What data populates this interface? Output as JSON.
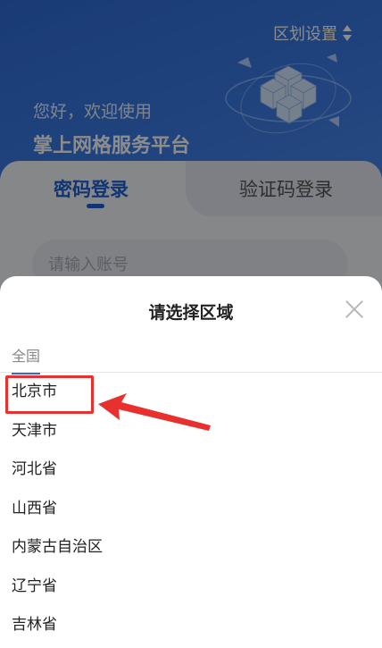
{
  "header": {
    "region_setting_label": "区划设置",
    "greeting": "您好，欢迎使用",
    "platform_title": "掌上网格服务平台"
  },
  "login": {
    "tabs": [
      {
        "label": "密码登录",
        "active": true
      },
      {
        "label": "验证码登录",
        "active": false
      }
    ],
    "account_placeholder": "请输入账号"
  },
  "region_picker": {
    "title": "请选择区域",
    "level_tab": "全国",
    "regions": [
      "北京市",
      "天津市",
      "河北省",
      "山西省",
      "内蒙古自治区",
      "辽宁省",
      "吉林省"
    ],
    "highlighted": "北京市"
  },
  "colors": {
    "brand_blue": "#2f6bd6",
    "annotation_red": "#e8312f"
  },
  "icons": [
    "sort-icon",
    "close-icon",
    "isometric-illustration"
  ]
}
